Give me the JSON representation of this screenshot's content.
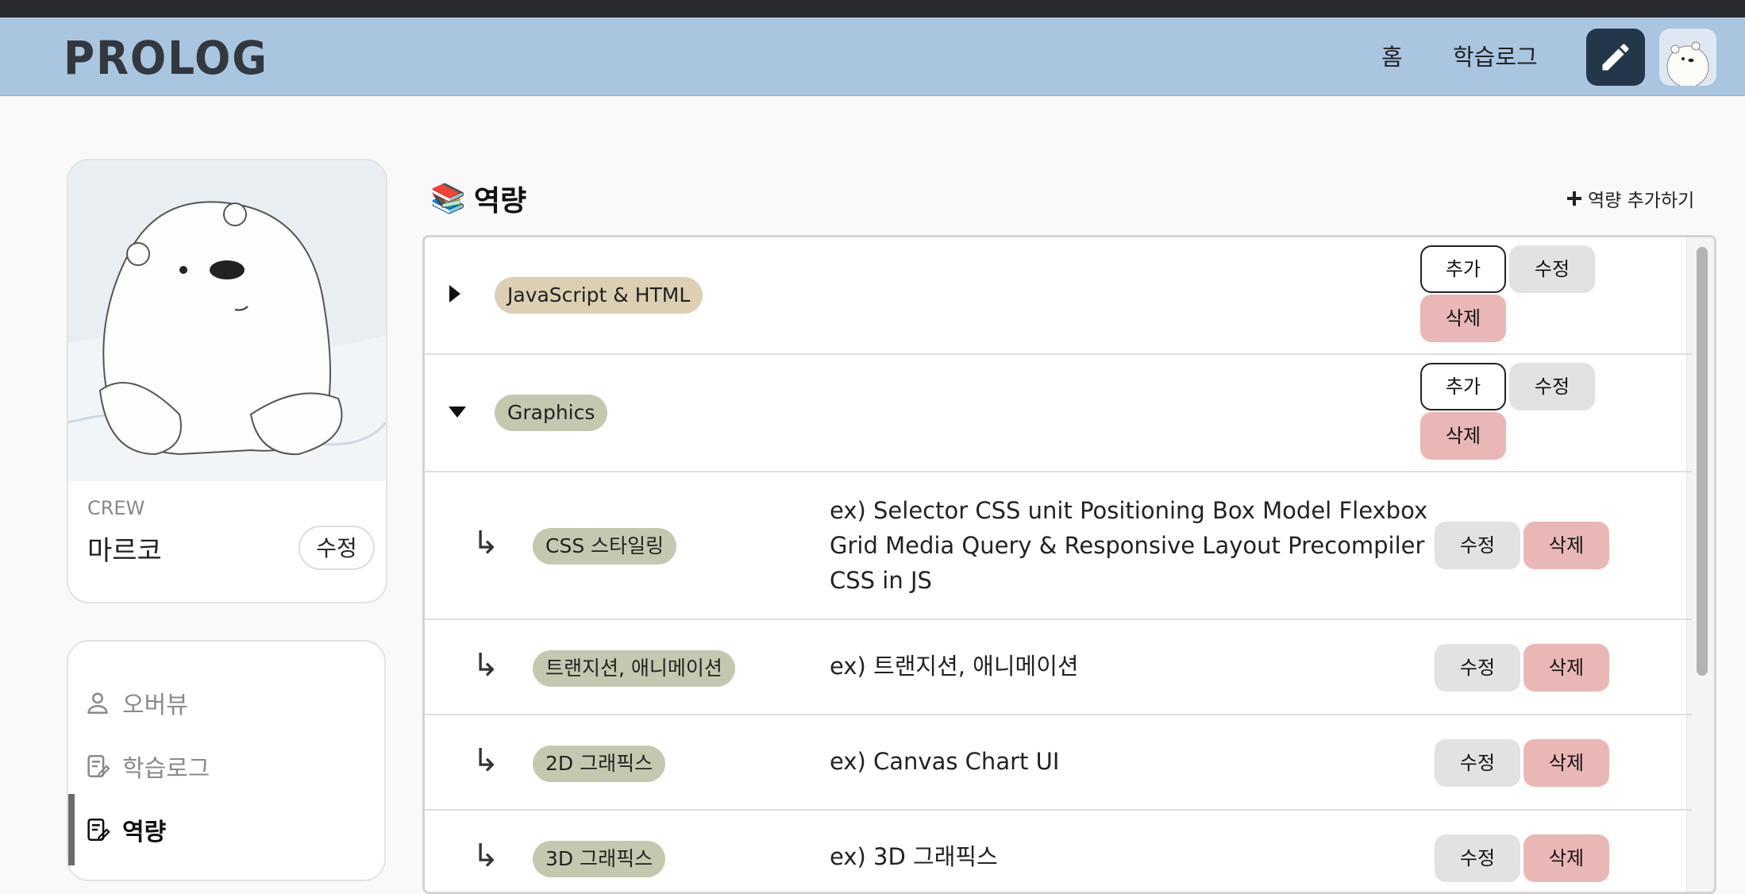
{
  "header": {
    "logo": "PROLOG",
    "nav": {
      "home": "홈",
      "study_log": "학습로그"
    }
  },
  "profile": {
    "role": "CREW",
    "name": "마르코",
    "edit_label": "수정"
  },
  "sidebar_menu": [
    {
      "label": "오버뷰",
      "icon": "user-icon",
      "active": false
    },
    {
      "label": "학습로그",
      "icon": "note-edit-icon",
      "active": false
    },
    {
      "label": "역량",
      "icon": "note-edit-icon",
      "active": true
    }
  ],
  "main": {
    "section_title": "역량",
    "section_emoji": "📚",
    "add_ability_label": "역량 추가하기",
    "buttons": {
      "add": "추가",
      "edit": "수정",
      "delete": "삭제"
    },
    "abilities": [
      {
        "name": "JavaScript & HTML",
        "expanded": false,
        "color": "#dccfb3"
      },
      {
        "name": "Graphics",
        "expanded": true,
        "color": "#c3c9b0"
      }
    ],
    "sub_abilities": [
      {
        "name": "CSS 스타일링",
        "description_lines": [
          "ex) Selector CSS unit Positioning Box Model Flexbox",
          "Grid Media Query & Responsive Layout Precompiler",
          "CSS in JS"
        ]
      },
      {
        "name": "트랜지션, 애니메이션",
        "description_lines": [
          "ex) 트랜지션, 애니메이션"
        ]
      },
      {
        "name": "2D 그래픽스",
        "description_lines": [
          "ex) Canvas Chart UI"
        ]
      },
      {
        "name": "3D 그래픽스",
        "description_lines": [
          "ex) 3D 그래픽스"
        ]
      }
    ]
  },
  "colors": {
    "header_bg": "#a9c5e0",
    "write_button_bg": "#24364a",
    "delete_bg": "#eab7b7",
    "edit_bg": "#e2e2e2"
  }
}
